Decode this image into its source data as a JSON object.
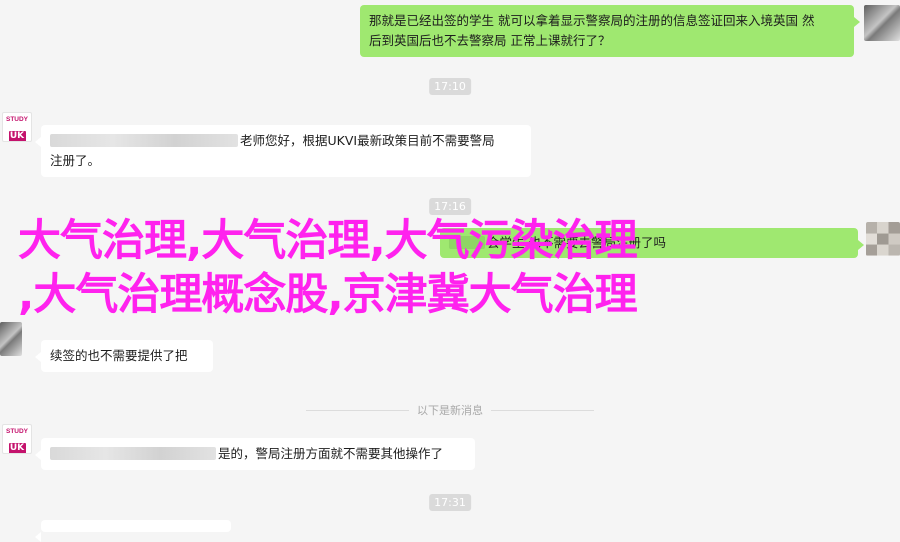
{
  "messages": {
    "m1": {
      "line1": "那就是已经出签的学生 就可以拿着显示警察局的注册的信息签证回来入境英国 然",
      "line2": "后到英国后也不去警察局 正常上课就行了？"
    },
    "t1": "17:10",
    "m2": {
      "line1_text": "老师您好，根据UKVI最新政策目前不需要警局",
      "line2": "注册了。"
    },
    "t2": "17:16",
    "m3": {
      "text": "会学生 也不需要去警局注册了吗"
    },
    "m4": {
      "text": "续签的也不需要提供了把"
    },
    "separator": "以下是新消息",
    "m5": {
      "text": "是的，警局注册方面就不需要其他操作了"
    },
    "t3": "17:31"
  },
  "avatars": {
    "study_uk_top": "STUDY",
    "study_uk_k": "UK"
  },
  "overlay": {
    "line1": "大气治理,大气治理,大气污染治理",
    "line2": ",大气治理概念股,京津冀大气治理"
  },
  "colors": {
    "outgoing_bubble": "#9fe870",
    "incoming_bubble": "#ffffff",
    "overlay_text": "#ff22ee",
    "background": "#f5f5f5"
  }
}
